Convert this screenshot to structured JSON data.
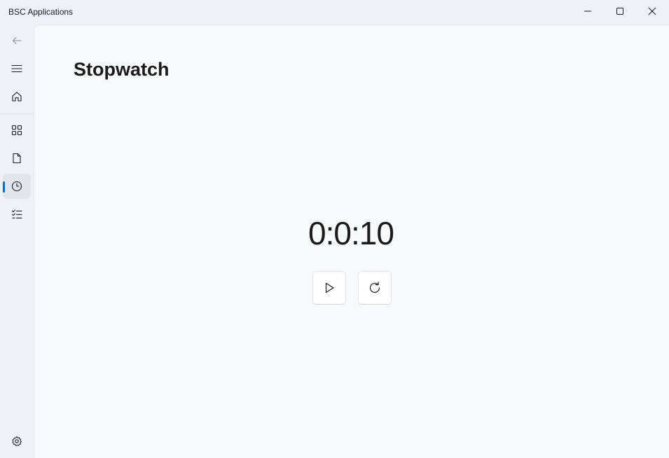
{
  "window": {
    "title": "BSC Applications"
  },
  "caption_buttons": {
    "minimize_icon": "minimize-icon",
    "maximize_icon": "maximize-icon",
    "close_icon": "close-icon"
  },
  "nav": {
    "back_icon": "back-arrow-icon",
    "menu_icon": "hamburger-menu-icon",
    "items": [
      {
        "icon": "home-icon"
      },
      {
        "icon": "apps-grid-icon"
      },
      {
        "icon": "document-icon"
      },
      {
        "icon": "clock-icon",
        "selected": true
      },
      {
        "icon": "checklist-icon"
      }
    ],
    "settings_icon": "settings-icon"
  },
  "page": {
    "title": "Stopwatch",
    "elapsed": "0:0:10"
  },
  "controls": {
    "start_icon": "play-icon",
    "reset_icon": "reset-icon"
  },
  "colors": {
    "accent": "#0f6cbd",
    "window_bg": "#eef2f6",
    "content_bg": "#f8f9fb"
  }
}
